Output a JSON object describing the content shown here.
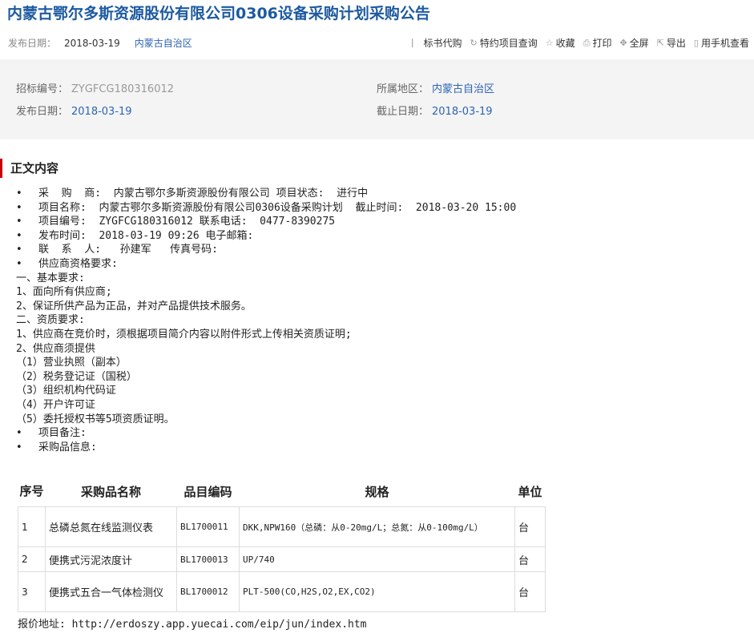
{
  "page": {
    "title": "内蒙古鄂尔多斯资源股份有限公司0306设备采购计划采购公告",
    "publish_label": "发布日期：",
    "publish_date": "2018-03-19",
    "region": "内蒙古自治区"
  },
  "toolbar": [
    {
      "icon": "bookmark-icon",
      "glyph": "⎸",
      "label": "标书代购"
    },
    {
      "icon": "query-icon",
      "glyph": "↻",
      "label": "特约项目查询"
    },
    {
      "icon": "star-icon",
      "glyph": "☆",
      "label": "收藏"
    },
    {
      "icon": "print-icon",
      "glyph": "⎙",
      "label": "打印"
    },
    {
      "icon": "fullscreen-icon",
      "glyph": "✥",
      "label": "全屏"
    },
    {
      "icon": "export-icon",
      "glyph": "⇱",
      "label": "导出"
    },
    {
      "icon": "mobile-icon",
      "glyph": "▯",
      "label": "用手机查看"
    }
  ],
  "info": {
    "bid_no_label": "招标编号：",
    "bid_no": "ZYGFCG180316012",
    "region_label": "所属地区：",
    "region": "内蒙古自治区",
    "publish_label": "发布日期：",
    "publish_date": "2018-03-19",
    "deadline_label": "截止日期：",
    "deadline": "2018-03-19"
  },
  "section_title": "正文内容",
  "content_lines": [
    {
      "bullet": true,
      "text": "采  购  商:  内蒙古鄂尔多斯资源股份有限公司 项目状态:  进行中"
    },
    {
      "bullet": true,
      "text": "项目名称:  内蒙古鄂尔多斯资源股份有限公司0306设备采购计划  截止时间:  2018-03-20 15:00"
    },
    {
      "bullet": true,
      "text": "项目编号:  ZYGFCG180316012 联系电话:  0477-8390275"
    },
    {
      "bullet": true,
      "text": "发布时间:  2018-03-19 09:26 电子邮箱:"
    },
    {
      "bullet": true,
      "text": "联  系  人:   孙建军   传真号码:"
    },
    {
      "bullet": true,
      "text": "供应商资格要求:"
    },
    {
      "bullet": false,
      "text": "一、基本要求:"
    },
    {
      "bullet": false,
      "text": "1、面向所有供应商;"
    },
    {
      "bullet": false,
      "text": "2、保证所供产品为正品，并对产品提供技术服务。"
    },
    {
      "bullet": false,
      "text": "二、资质要求:"
    },
    {
      "bullet": false,
      "text": "1、供应商在竞价时，须根据项目简介内容以附件形式上传相关资质证明;"
    },
    {
      "bullet": false,
      "text": "2、供应商须提供"
    },
    {
      "bullet": false,
      "text": "（1）营业执照（副本）"
    },
    {
      "bullet": false,
      "text": "（2）税务登记证（国税）"
    },
    {
      "bullet": false,
      "text": "（3）组织机构代码证"
    },
    {
      "bullet": false,
      "text": "（4）开户许可证"
    },
    {
      "bullet": false,
      "text": "（5）委托授权书等5项资质证明。"
    },
    {
      "bullet": true,
      "text": "项目备注:"
    },
    {
      "bullet": true,
      "text": "采购品信息:"
    }
  ],
  "table": {
    "headers": [
      "序号",
      "采购品名称",
      "品目编码",
      "规格",
      "单位"
    ],
    "rows": [
      [
        "1",
        "总磷总氮在线监测仪表",
        "BL1700011",
        "DKK,NPW160（总磷：从0-20mg/L；总氮：从0-100mg/L）",
        "台"
      ],
      [
        "2",
        "便携式污泥浓度计",
        "BL1700013",
        "UP/740",
        "台"
      ],
      [
        "3",
        "便携式五合一气体检测仪",
        "BL1700012",
        "PLT-500(CO,H2S,O2,EX,CO2)",
        "台"
      ]
    ]
  },
  "address": "报价地址:  http://erdoszy.app.yuecai.com/eip/jun/index.htm"
}
